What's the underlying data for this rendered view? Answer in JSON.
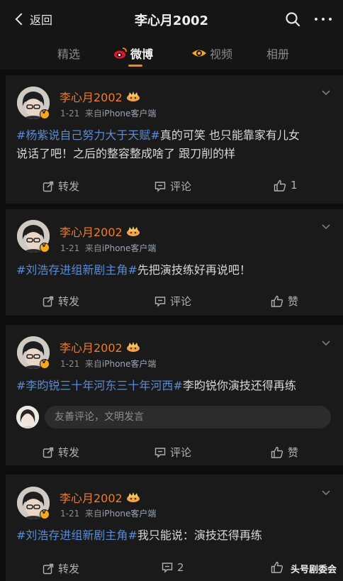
{
  "header": {
    "back_label": "返回",
    "title": "李心月2002"
  },
  "tabs": [
    {
      "label": "精选"
    },
    {
      "label": "微博"
    },
    {
      "label": "视频"
    },
    {
      "label": "相册"
    }
  ],
  "posts": [
    {
      "author": "李心月2002",
      "date": "1-21",
      "source_prefix": "来自",
      "source": "iPhone客户端",
      "topic": "#杨紫说自己努力大于天赋#",
      "text_line1": "真的可笑 也只能靠家有儿女",
      "text_line2": "说话了吧！之后的整容整成啥了 跟刀削的样",
      "repost_label": "转发",
      "comment_label": "评论",
      "like_label": "1"
    },
    {
      "author": "李心月2002",
      "date": "1-21",
      "source_prefix": "来自",
      "source": "iPhone客户端",
      "topic": "#刘浩存进组新剧主角#",
      "text": "先把演技练好再说吧！",
      "repost_label": "转发",
      "comment_label": "评论",
      "like_label": "赞"
    },
    {
      "author": "李心月2002",
      "date": "1-21",
      "source_prefix": "来自",
      "source": "iPhone客户端",
      "topic": "#李昀锐三十年河东三十年河西#",
      "text": "李昀锐你演技还得再练",
      "comment_placeholder": "友善评论，文明发言",
      "repost_label": "转发",
      "comment_label": "评论",
      "like_label": "赞"
    },
    {
      "author": "李心月2002",
      "date": "1-21",
      "source_prefix": "来自",
      "source": "iPhone客户端",
      "topic": "#刘浩存进组新剧主角#",
      "text": "我只能说：演技还得再练",
      "repost_label": "转发",
      "comment_label": "2",
      "like_label": ""
    }
  ],
  "watermark": "头号剧委会",
  "colors": {
    "accent": "#ff8200",
    "name": "#f07b2b",
    "topic": "#5b8bd1",
    "background": "#0d0d0d",
    "card": "#1a1a1a"
  }
}
